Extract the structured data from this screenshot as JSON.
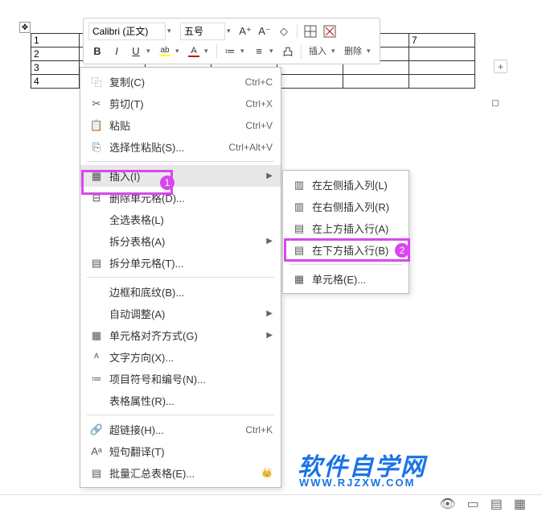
{
  "toolbar": {
    "font_name": "Calibri (正文)",
    "font_size": "五号",
    "insert_label": "插入",
    "delete_label": "删除"
  },
  "table": {
    "rows": [
      "1",
      "2",
      "3",
      "4"
    ],
    "header_right": "7"
  },
  "context_menu": {
    "copy": "复制(C)",
    "copy_sc": "Ctrl+C",
    "cut": "剪切(T)",
    "cut_sc": "Ctrl+X",
    "paste": "粘贴",
    "paste_sc": "Ctrl+V",
    "paste_special": "选择性粘贴(S)...",
    "paste_special_sc": "Ctrl+Alt+V",
    "insert": "插入(I)",
    "delete_cells": "删除单元格(D)...",
    "select_table": "全选表格(L)",
    "split_table": "拆分表格(A)",
    "split_cells": "拆分单元格(T)...",
    "borders": "边框和底纹(B)...",
    "autofit": "自动调整(A)",
    "cell_align": "单元格对齐方式(G)",
    "text_direction": "文字方向(X)...",
    "bullets": "项目符号和编号(N)...",
    "table_props": "表格属性(R)...",
    "hyperlink": "超链接(H)...",
    "hyperlink_sc": "Ctrl+K",
    "translate": "短句翻译(T)",
    "batch_summary": "批量汇总表格(E)..."
  },
  "submenu": {
    "insert_col_left": "在左侧插入列(L)",
    "insert_col_right": "在右侧插入列(R)",
    "insert_row_above": "在上方插入行(A)",
    "insert_row_below": "在下方插入行(B)",
    "cells": "单元格(E)..."
  },
  "annotations": {
    "step1": "1",
    "step2": "2"
  },
  "watermark": {
    "title": "软件自学网",
    "url": "WWW.RJZXW.COM"
  }
}
